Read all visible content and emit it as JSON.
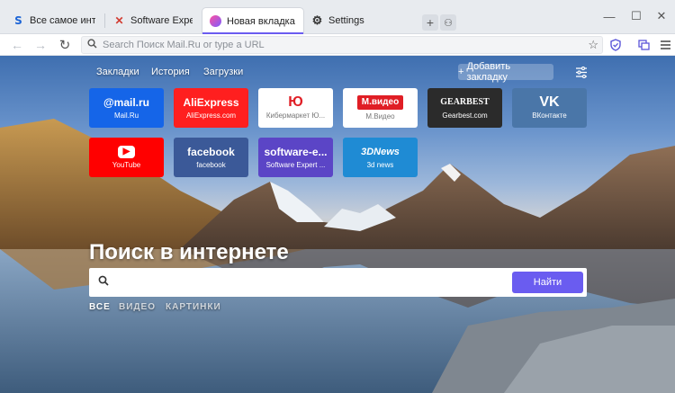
{
  "tabs": [
    {
      "label": "Все самое интересное",
      "icon": "mailru-s-icon",
      "active": false
    },
    {
      "label": "Software Expert -- Всё",
      "icon": "software-expert-icon",
      "active": false
    },
    {
      "label": "Новая вкладка",
      "icon": "new-tab-icon",
      "active": true
    },
    {
      "label": "Settings",
      "icon": "gear-icon",
      "active": false
    }
  ],
  "tab_actions": {
    "new_tab": "+",
    "incognito": "⚇"
  },
  "window_controls": {
    "minimize": "—",
    "maximize": "☐",
    "close": "✕"
  },
  "address_bar": {
    "placeholder": "Search Поиск Mail.Ru or type a URL",
    "back": "←",
    "forward": "→",
    "reload": "↻",
    "star": "☆"
  },
  "ntp": {
    "links": {
      "bookmarks": "Закладки",
      "history": "История",
      "downloads": "Загрузки"
    },
    "add_bookmark": "Добавить закладку",
    "add_bookmark_plus": "+",
    "tiles": [
      {
        "logo": "@mail.ru",
        "caption": "Mail.Ru",
        "bg": "#1565e8",
        "fg": "#ffffff"
      },
      {
        "logo": "AliExpress",
        "caption": "AliExpress.com",
        "bg": "#ff1f1f",
        "fg": "#ffffff"
      },
      {
        "logo": "Ю",
        "caption": "Кибермаркет Ю...",
        "bg": "#ffffff",
        "fg": "#e01e25"
      },
      {
        "logo": "М.видео",
        "caption": "М.Видео",
        "bg": "#ffffff",
        "fg": "#e01e25"
      },
      {
        "logo": "GEARBEST",
        "caption": "Gearbest.com",
        "bg": "#2b2b2b",
        "fg": "#ffffff"
      },
      {
        "logo": "VK",
        "caption": "ВКонтакте",
        "bg": "#4a76a8",
        "fg": "#ffffff"
      },
      {
        "logo": "▶",
        "caption": "YouTube",
        "bg": "#ff0000",
        "fg": "#ffffff"
      },
      {
        "logo": "facebook",
        "caption": "facebook",
        "bg": "#3b5998",
        "fg": "#ffffff"
      },
      {
        "logo": "software-e...",
        "caption": "Software Expert ...",
        "bg": "#5b45c6",
        "fg": "#ffffff"
      },
      {
        "logo": "3DNews",
        "caption": "3d news",
        "bg": "#1f8bd4",
        "fg": "#ffffff"
      }
    ],
    "search_title": "Поиск в интернете",
    "search_button": "Найти",
    "categories": [
      "ВСЕ",
      "ВИДЕО",
      "КАРТИНКИ"
    ]
  },
  "colors": {
    "accent": "#6a5cf0"
  }
}
